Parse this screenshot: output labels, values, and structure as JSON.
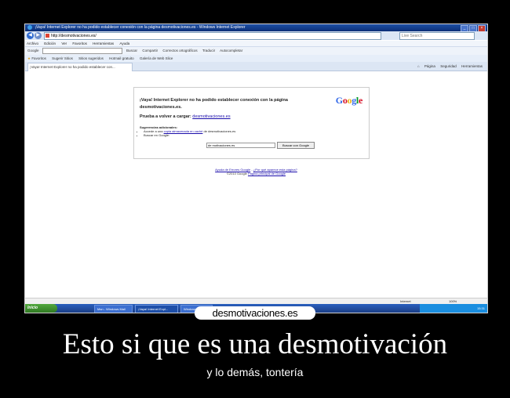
{
  "window": {
    "title": "¡Vaya! Internet Explorer no ha podido establecer conexión con la página desmotivaciones.es - Windows Internet Explorer",
    "address": "http://desmotivaciones.es/",
    "search_placeholder": "Live Search"
  },
  "menu": [
    "Archivo",
    "Edición",
    "Ver",
    "Favoritos",
    "Herramientas",
    "Ayuda"
  ],
  "google_toolbar": {
    "label": "Google",
    "items": [
      "Buscar",
      "Compartir",
      "Correctos ortográficos",
      "Traducir",
      "Autocompletar"
    ]
  },
  "favorites_bar": {
    "label": "Favoritos",
    "items": [
      "Sugerir Sitios",
      "Sitios sugeridos",
      "Hotmail gratuito",
      "Galería de Web Slice"
    ]
  },
  "tab": {
    "label": "¡Vaya! Internet Explorer no ha podido establecer con..."
  },
  "command_bar": [
    "Página",
    "Seguridad",
    "Herramientas"
  ],
  "error_page": {
    "heading": "¡Vaya! Internet Explorer no ha podido establecer conexión con la página desmotivaciones.es.",
    "logo": "Google",
    "retry_prefix": "Prueba a volver a cargar:",
    "retry_link": "desmotivaciones.es",
    "suggestions_title": "Sugerencias adicionales:",
    "suggestion_1_pre": "Accede a una",
    "suggestion_1_link": "copia almacenada en caché",
    "suggestion_1_post": "de desmotivaciones.es",
    "suggestion_2": "Buscar en Google:",
    "search_value": "de motivaciones es",
    "search_button": "Buscar con Google"
  },
  "footer": {
    "link_1": "Ayuda de Errores Google",
    "link_2": "¿Por qué aparece esta página?",
    "copyright_pre": "©2010 Google",
    "copyright_link": "Página principal de Google"
  },
  "status": {
    "zone": "Internet",
    "zoom": "100%"
  },
  "taskbar": {
    "start": "Inicio",
    "buttons": [
      "Msn - Windows Mail",
      "¡Vaya! Internet Expl...",
      "Windows Live"
    ],
    "tray_time": "15:31"
  },
  "poster": {
    "brand": "desmotivaciones.es",
    "caption": "Esto si que es una desmotivación",
    "subcaption": "y lo demás, tontería"
  },
  "colors": {
    "background": "#000000",
    "caption": "#ffffff",
    "link": "#1a0dab",
    "google_blue": "#3369e8",
    "google_red": "#d50f25",
    "google_yellow": "#eeb211",
    "google_green": "#009925"
  }
}
